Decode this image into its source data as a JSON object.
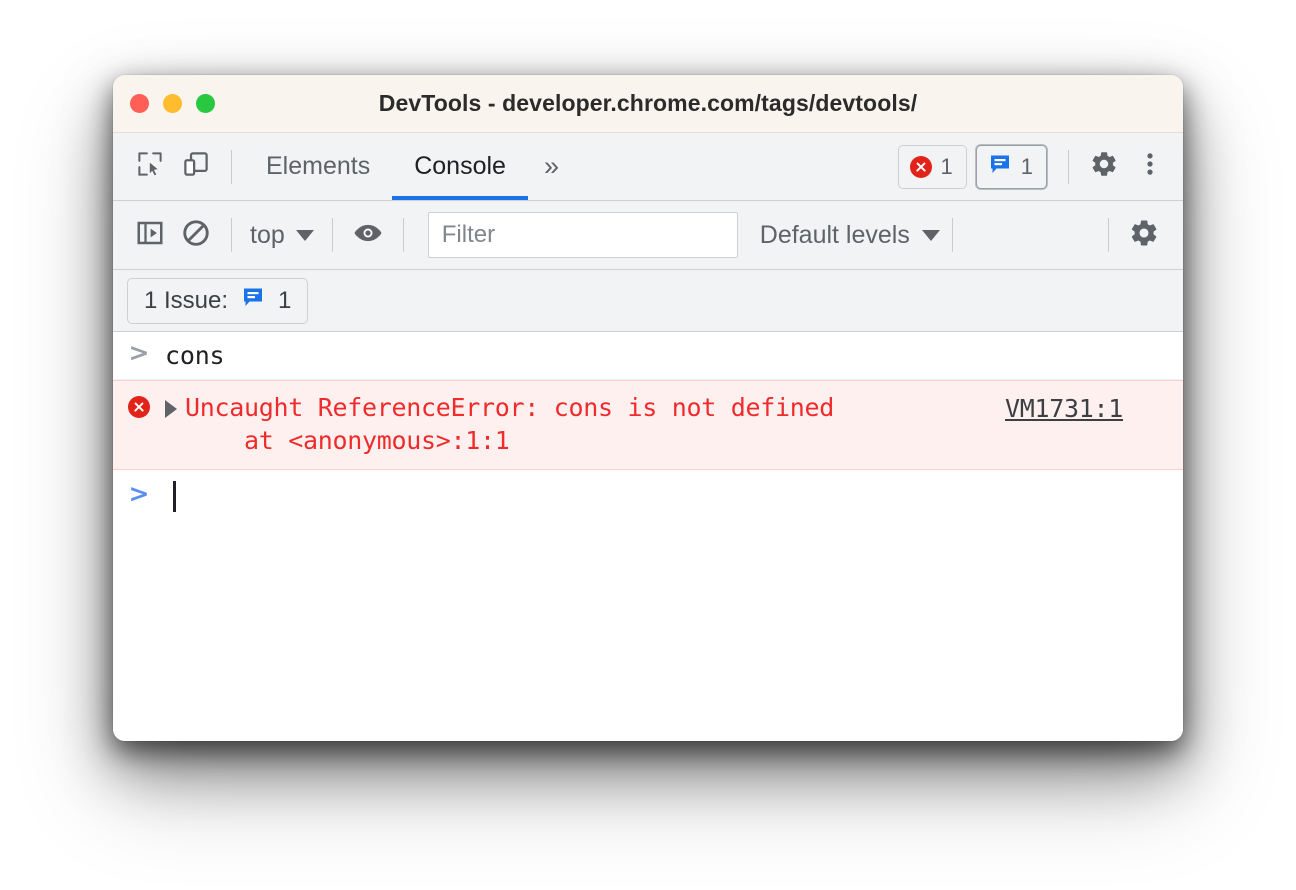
{
  "window": {
    "title": "DevTools - developer.chrome.com/tags/devtools/",
    "traffic_lights": {
      "close": "close-window",
      "minimize": "minimize-window",
      "maximize": "maximize-window"
    }
  },
  "tabbar": {
    "inspect_icon": "inspect-element-icon",
    "device_icon": "device-toolbar-icon",
    "tabs": [
      {
        "label": "Elements",
        "active": false
      },
      {
        "label": "Console",
        "active": true
      }
    ],
    "more_tabs": "»",
    "errors": {
      "icon": "error-circle-icon",
      "count": "1"
    },
    "issues": {
      "icon": "issue-message-icon",
      "count": "1"
    },
    "settings_icon": "gear-icon",
    "more_menu_icon": "kebab-menu-icon"
  },
  "console_toolbar": {
    "sidebar_toggle_icon": "console-sidebar-icon",
    "clear_icon": "clear-console-icon",
    "context": "top",
    "context_caret": "chevron-down-icon",
    "live_expression_icon": "eye-icon",
    "filter": {
      "placeholder": "Filter",
      "value": ""
    },
    "levels": "Default levels",
    "levels_caret": "chevron-down-icon",
    "settings_icon": "gear-icon"
  },
  "issues_bar": {
    "label": "1 Issue:",
    "icon": "issue-message-icon",
    "count": "1"
  },
  "console": {
    "entries": [
      {
        "type": "input",
        "prompt": ">",
        "text": "cons"
      },
      {
        "type": "error",
        "icon": "error-circle-icon",
        "expand": "expand-triangle-icon",
        "message_line1": "Uncaught ReferenceError: cons is not defined",
        "message_line2": "    at <anonymous>:1:1",
        "source_link": "VM1731:1"
      },
      {
        "type": "prompt",
        "prompt": ">",
        "value": ""
      }
    ]
  },
  "colors": {
    "accent_blue": "#1a73e8",
    "error_red": "#ef2b2b",
    "error_bg": "#fff0f0",
    "error_icon": "#e2231a",
    "issue_blue": "#1a73e8",
    "titlebar_bg": "#f9f4ed",
    "toolbar_bg": "#f1f3f4"
  }
}
